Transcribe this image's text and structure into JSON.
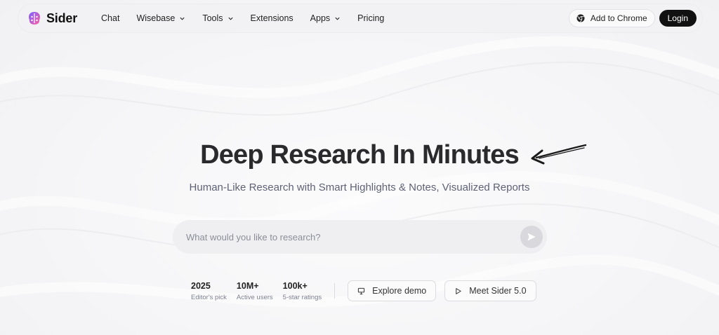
{
  "brand": {
    "name": "Sider"
  },
  "nav": {
    "items": [
      {
        "label": "Chat",
        "dropdown": false
      },
      {
        "label": "Wisebase",
        "dropdown": true
      },
      {
        "label": "Tools",
        "dropdown": true
      },
      {
        "label": "Extensions",
        "dropdown": false
      },
      {
        "label": "Apps",
        "dropdown": true
      },
      {
        "label": "Pricing",
        "dropdown": false
      }
    ],
    "add_to_chrome": "Add to Chrome",
    "login": "Login"
  },
  "hero": {
    "title": "Deep Research In Minutes",
    "subtitle": "Human-Like Research with Smart Highlights & Notes, Visualized Reports"
  },
  "search": {
    "placeholder": "What would you like to research?"
  },
  "stats": [
    {
      "value": "2025",
      "label": "Editor's pick"
    },
    {
      "value": "10M+",
      "label": "Active users"
    },
    {
      "value": "100k+",
      "label": "5-star ratings"
    }
  ],
  "actions": {
    "explore_demo": "Explore demo",
    "meet_sider": "Meet Sider 5.0"
  },
  "colors": {
    "accent": "#111111",
    "brand_gradient": [
      "#7b61ff",
      "#ff5fa2"
    ]
  }
}
